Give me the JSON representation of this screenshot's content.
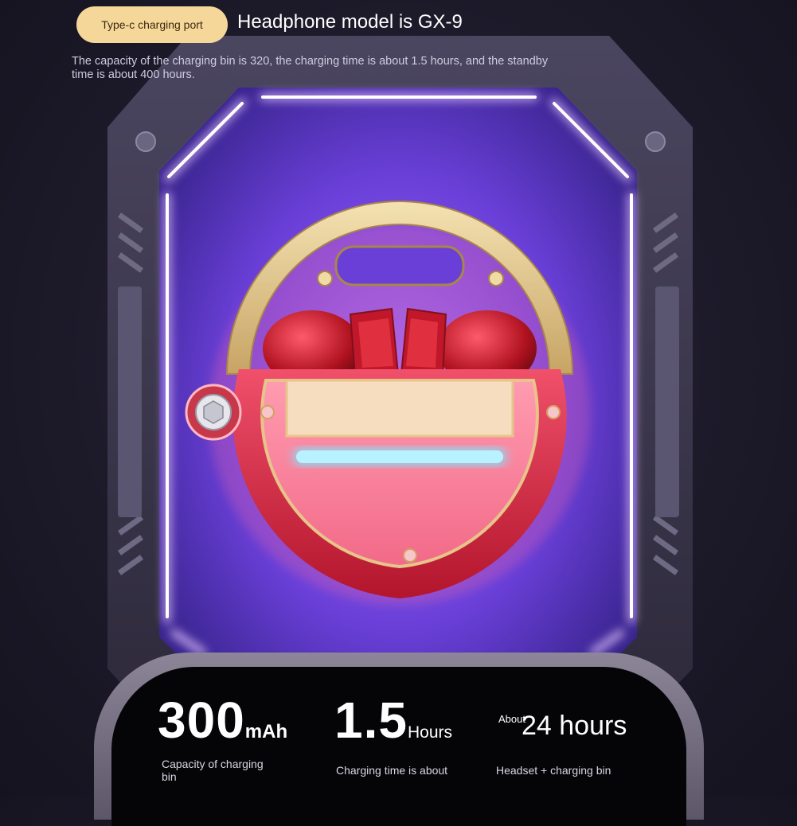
{
  "header": {
    "badge": "Type-c charging port",
    "title": "Headphone model is GX-9",
    "description": "The capacity of the charging bin is 320, the charging time is about 1.5 hours, and the standby time is about 400 hours."
  },
  "stats": [
    {
      "value": "300",
      "unit": "mAh",
      "caption": "Capacity of charging bin"
    },
    {
      "value": "1.5",
      "unit": "Hours",
      "caption": "Charging time is about"
    },
    {
      "prefix": "About",
      "value": "24 hours",
      "caption": "Headset + charging bin"
    }
  ],
  "colors": {
    "accent_badge": "#f6d79a",
    "neon": "#c58cff",
    "case_red": "#d8243a",
    "case_gold": "#e2c98a"
  }
}
